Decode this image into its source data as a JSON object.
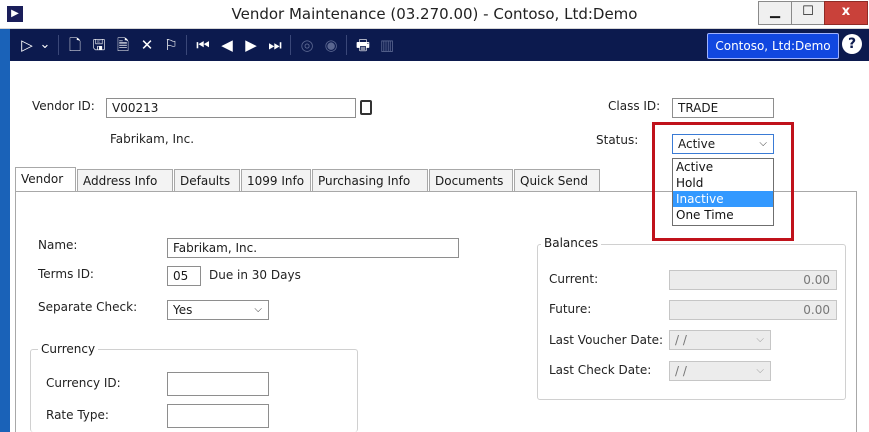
{
  "window": {
    "title": "Vendor Maintenance (03.270.00) - Contoso, Ltd:Demo",
    "minimize": "▁",
    "maximize": "☐",
    "close": "x"
  },
  "toolbar": {
    "company": "Contoso, Ltd:Demo",
    "help": "?",
    "icons": {
      "menu": "▷",
      "dropdown": "⌄",
      "new": "🗋",
      "save": "🖫",
      "save_as": "🗎",
      "delete": "✕",
      "flag": "⚐",
      "first": "⏮",
      "prev": "◀",
      "next": "▶",
      "last": "⏭",
      "options": "◎",
      "hidden": "◉",
      "print": "🖶",
      "export": "▥"
    }
  },
  "header": {
    "vendor_id_label": "Vendor ID:",
    "vendor_id": "V00213",
    "vendor_name": "Fabrikam, Inc.",
    "class_id_label": "Class ID:",
    "class_id": "TRADE",
    "status_label": "Status:",
    "status_value": "Active"
  },
  "status_options": [
    "Active",
    "Hold",
    "Inactive",
    "One Time"
  ],
  "tabs": [
    "Vendor",
    "Address Info",
    "Defaults",
    "1099 Info",
    "Purchasing Info",
    "Documents",
    "Quick Send"
  ],
  "vendor_tab": {
    "name_label": "Name:",
    "name": "Fabrikam, Inc.",
    "terms_label": "Terms ID:",
    "terms_id": "05",
    "terms_desc": "Due in 30 Days",
    "sep_check_label": "Separate Check:",
    "sep_check": "Yes",
    "currency_group": "Currency",
    "currency_id_label": "Currency ID:",
    "currency_id": "",
    "rate_type_label": "Rate Type:",
    "rate_type": "",
    "balances_group": "Balances",
    "current_label": "Current:",
    "current": "0.00",
    "future_label": "Future:",
    "future": "0.00",
    "last_voucher_label": "Last Voucher Date:",
    "last_voucher": "/ /",
    "last_check_label": "Last Check Date:",
    "last_check": "/ /"
  },
  "colors": {
    "toolbar_bg": "#0c1a4e",
    "company_btn": "#1147e0",
    "highlight": "#c0121b",
    "selected_option": "#3399ff"
  }
}
